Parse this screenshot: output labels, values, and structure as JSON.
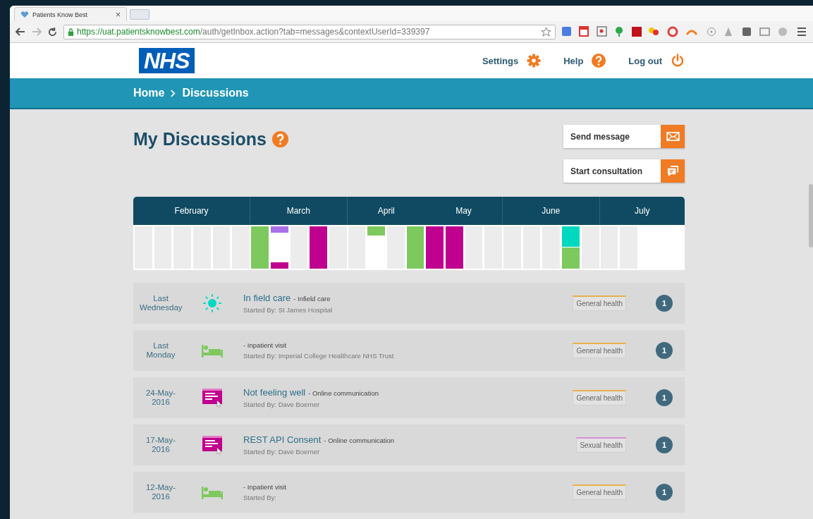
{
  "browser": {
    "tab": {
      "title": "Patients Know Best",
      "close": "×"
    },
    "url": {
      "host": "https://uat.patientsknowbest.com",
      "path": "/auth/getInbox.action?tab=messages&contextUserId=339397"
    }
  },
  "header": {
    "logo": "NHS",
    "links": [
      {
        "label": "Settings",
        "kind": "gear"
      },
      {
        "label": "Help",
        "kind": "help"
      },
      {
        "label": "Log out",
        "kind": "power"
      }
    ]
  },
  "breadcrumb": [
    "Home",
    "Discussions"
  ],
  "page_title": "My Discussions",
  "actions": [
    {
      "label": "Send message",
      "kind": "mail"
    },
    {
      "label": "Start consultation",
      "kind": "chat"
    }
  ],
  "timeline": [
    {
      "labels": [
        "February"
      ],
      "columns": [
        [],
        [],
        [],
        [],
        [],
        []
      ]
    },
    {
      "labels": [
        "March"
      ],
      "columns": [
        [
          {
            "color": "#7dc95e",
            "level": 1
          }
        ],
        [
          {
            "color": "#a970e8",
            "level": 0.15
          },
          {
            "color": "#c0008e",
            "level": 0.15
          }
        ],
        [],
        [
          {
            "color": "#c0008e",
            "level": 1
          }
        ],
        []
      ]
    },
    {
      "labels": [
        "April",
        "May"
      ],
      "columns": [
        [],
        [
          {
            "color": "#7dc95e",
            "level": 0.22
          }
        ],
        [],
        [
          {
            "color": "#7dc95e",
            "level": 1
          }
        ],
        [
          {
            "color": "#c0008e",
            "level": 1
          }
        ],
        [
          {
            "color": "#c0008e",
            "level": 1
          }
        ],
        [],
        []
      ]
    },
    {
      "labels": [
        "June"
      ],
      "columns": [
        [],
        [],
        [],
        [
          {
            "color": "#00d9c0",
            "level": 0.48
          },
          {
            "color": "#7dc95e",
            "level": 0.5
          }
        ],
        []
      ]
    },
    {
      "labels": [
        "July"
      ],
      "columns": [
        [],
        []
      ]
    }
  ],
  "discussions": [
    {
      "date": "Last Wednesday",
      "kind": "sun",
      "title": "In field care",
      "type": "- Infield care",
      "started_by": "Started By: St James Hospital",
      "tag": {
        "label": "General health",
        "color": "#e8b04a"
      },
      "count": "1"
    },
    {
      "date": "Last Monday",
      "kind": "bed",
      "type": "- Inpatient visit",
      "started_by": "Started By: Imperial College Healthcare NHS Trust",
      "tag": {
        "label": "General health",
        "color": "#e8b04a"
      },
      "count": "1"
    },
    {
      "date": "24-May-2016",
      "kind": "form",
      "title": "Not feeling well",
      "type": "- Online communication",
      "started_by": "Started By: Dave Boerner",
      "tag": {
        "label": "General health",
        "color": "#e8b04a"
      },
      "count": "1"
    },
    {
      "date": "17-May-2016",
      "kind": "form",
      "title": "REST API Consent",
      "type": "- Online communication",
      "started_by": "Started By: Dave Boerner",
      "tag": {
        "label": "Sexual health",
        "color": "#d490d4"
      },
      "count": "1"
    },
    {
      "date": "12-May-2016",
      "kind": "bed",
      "type": "- Inpatient visit",
      "started_by": "Started By:",
      "tag": {
        "label": "General health",
        "color": "#e8b04a"
      },
      "count": "1"
    }
  ]
}
